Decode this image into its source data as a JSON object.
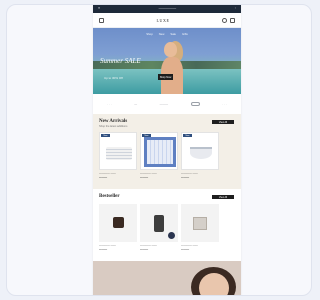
{
  "store": {
    "logo": "LUXE"
  },
  "topbar": {
    "left": "≡",
    "center": "—————",
    "right": "◦"
  },
  "hero": {
    "menu": [
      "Shop",
      "New",
      "Sale",
      "Gifts"
    ],
    "headline": "Summer SALE",
    "sub": "Up to 30% Off",
    "cta": "Shop Now"
  },
  "categories": {
    "items": [
      "· · ·",
      "—",
      "———",
      "———",
      "· · ·"
    ]
  },
  "new_arrivals": {
    "title": "New Arrivals",
    "subtitle": "Shop the latest additions",
    "view_all": "View All",
    "tag": "New",
    "products": [
      {
        "art": "stack",
        "name": "———— ——",
        "price": "———"
      },
      {
        "art": "blue-frame",
        "name": "———— ——",
        "price": "———"
      },
      {
        "art": "bowl",
        "name": "———— ——",
        "price": "———"
      },
      {
        "art": "ring-plate",
        "name": "———— ——",
        "price": "———"
      }
    ]
  },
  "bestseller": {
    "title": "Bestseller",
    "view_all": "View All",
    "products": [
      {
        "art": "dark",
        "name": "———— ——",
        "price": "———"
      },
      {
        "art": "candle",
        "name": "———— ——",
        "price": "———"
      },
      {
        "art": "cube",
        "name": "———— ——",
        "price": "———"
      },
      {
        "art": "cup",
        "name": "———— ——",
        "price": "———"
      }
    ]
  }
}
